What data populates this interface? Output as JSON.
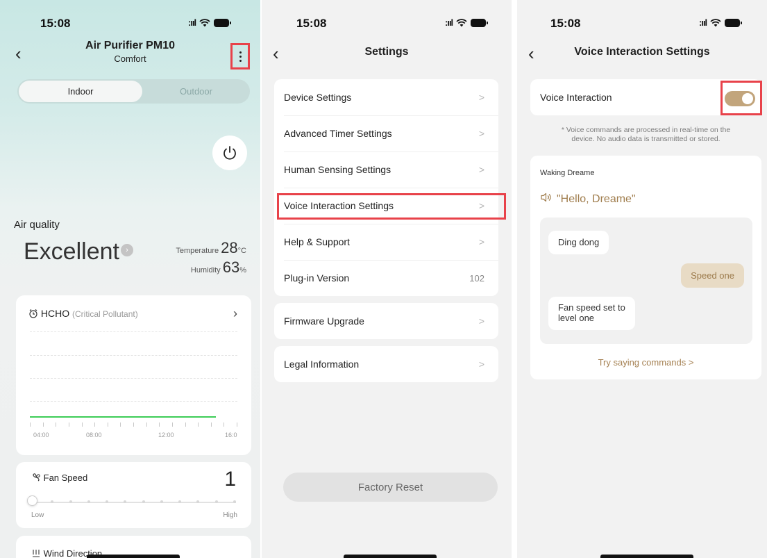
{
  "colors": {
    "accent_red_highlight": "#e8424a",
    "gold_accent": "#a07d4d",
    "toggle_on": "#c2a57c",
    "chart_green": "#3dcc56",
    "teal_background": "#c8e7e4"
  },
  "screen1": {
    "status_time": "15:08",
    "title": "Air Purifier PM10",
    "subtitle": "Comfort",
    "back_icon": "chevron-left-icon",
    "more_icon": "more-vertical-icon",
    "tabs": {
      "indoor": "Indoor",
      "outdoor": "Outdoor",
      "selected": "Indoor"
    },
    "power_icon": "power-icon",
    "air_quality_label": "Air quality",
    "air_quality_value": "Excellent",
    "temperature_label": "Temperature",
    "temperature_value": "28",
    "temperature_unit": "°C",
    "humidity_label": "Humidity",
    "humidity_value": "63",
    "humidity_unit": "%",
    "hcho_title": "HCHO",
    "hcho_subtitle": "(Critical Pollutant)",
    "chart_x_labels": [
      "04:00",
      "08:00",
      "12:00",
      "16:0"
    ],
    "fan_speed_label": "Fan Speed",
    "fan_speed_value": "1",
    "fan_low": "Low",
    "fan_high": "High",
    "fan_level_fraction": 0,
    "wind_direction_label": "Wind Direction"
  },
  "screen2": {
    "status_time": "15:08",
    "title": "Settings",
    "group1": [
      {
        "label": "Device Settings"
      },
      {
        "label": "Advanced Timer Settings"
      },
      {
        "label": "Human Sensing Settings"
      },
      {
        "label": "Voice Interaction Settings"
      },
      {
        "label": "Help & Support"
      },
      {
        "label": "Plug-in Version",
        "value": "102"
      }
    ],
    "firmware_label": "Firmware Upgrade",
    "legal_label": "Legal Information",
    "factory_reset_label": "Factory Reset",
    "arrow_glyph": ">"
  },
  "screen3": {
    "status_time": "15:08",
    "title": "Voice Interaction Settings",
    "voice_interaction_label": "Voice Interaction",
    "voice_interaction_enabled": true,
    "note_line1": "* Voice commands are processed in real-time on the",
    "note_line2": "device. No audio data is transmitted or stored.",
    "waking_label": "Waking Dreame",
    "wake_phrase": "\"Hello, Dreame\"",
    "speaker_icon": "speaker-icon",
    "chat": {
      "bubble1": "Ding dong",
      "bubble2": "Speed one",
      "bubble3_line1": "Fan speed set to",
      "bubble3_line2": "level one"
    },
    "try_saying": "Try saying commands >"
  }
}
